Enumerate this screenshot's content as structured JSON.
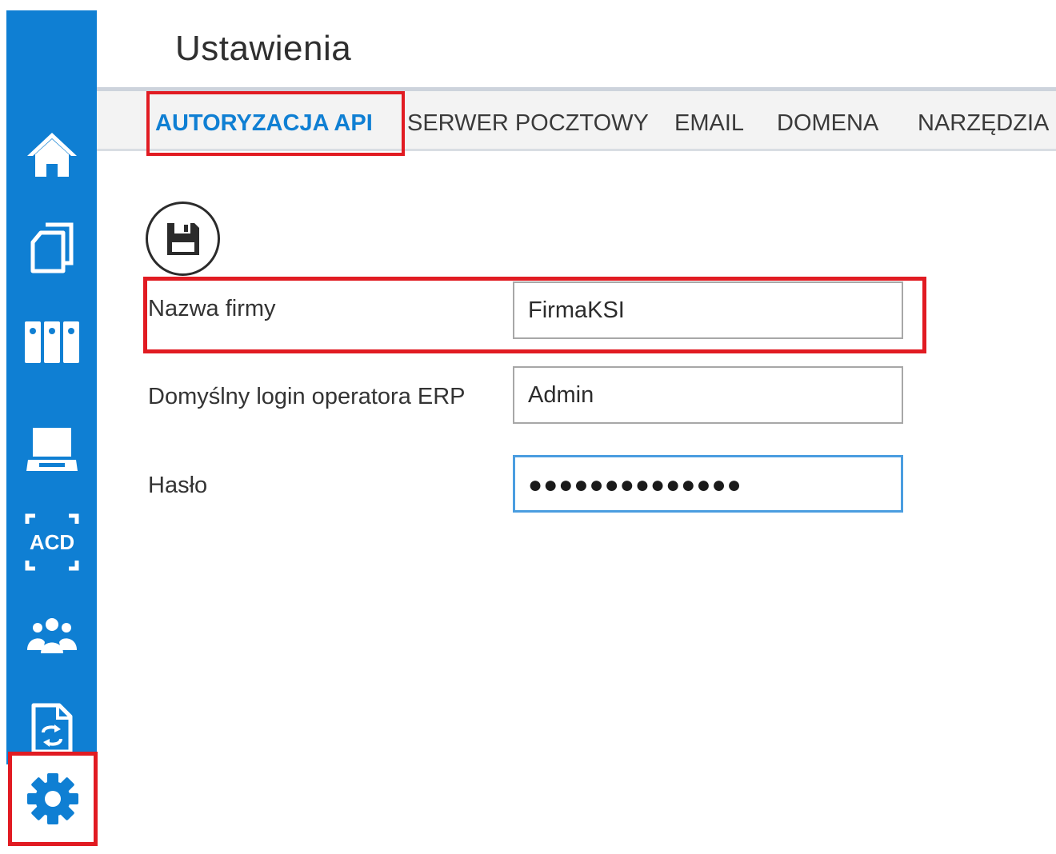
{
  "page": {
    "title": "Ustawienia"
  },
  "sidebar": {
    "accent_color": "#0f7fd3",
    "items": [
      {
        "name": "home",
        "icon": "home-icon"
      },
      {
        "name": "documents",
        "icon": "documents-icon"
      },
      {
        "name": "binders",
        "icon": "binders-icon"
      },
      {
        "name": "scanner",
        "icon": "scanner-icon"
      },
      {
        "name": "acd",
        "icon": "acd-ocr-icon",
        "label": "ACD"
      },
      {
        "name": "users",
        "icon": "users-group-icon"
      },
      {
        "name": "sync",
        "icon": "document-sync-icon"
      },
      {
        "name": "settings",
        "icon": "gear-icon",
        "selected": true
      }
    ]
  },
  "tabs": [
    {
      "label": "AUTORYZACJA API",
      "active": true
    },
    {
      "label": "SERWER POCZTOWY",
      "active": false
    },
    {
      "label": "EMAIL",
      "active": false
    },
    {
      "label": "DOMENA",
      "active": false
    },
    {
      "label": "NARZĘDZIA",
      "active": false
    }
  ],
  "toolbar": {
    "save_icon": "floppy-disk-icon"
  },
  "form": {
    "company_label": "Nazwa firmy",
    "company_value": "FirmaKSI",
    "login_label": "Domyślny login operatora ERP",
    "login_value": "Admin",
    "password_label": "Hasło",
    "password_masked": "●●●●●●●●●●●●●●"
  },
  "highlight_color": "#e11b22"
}
